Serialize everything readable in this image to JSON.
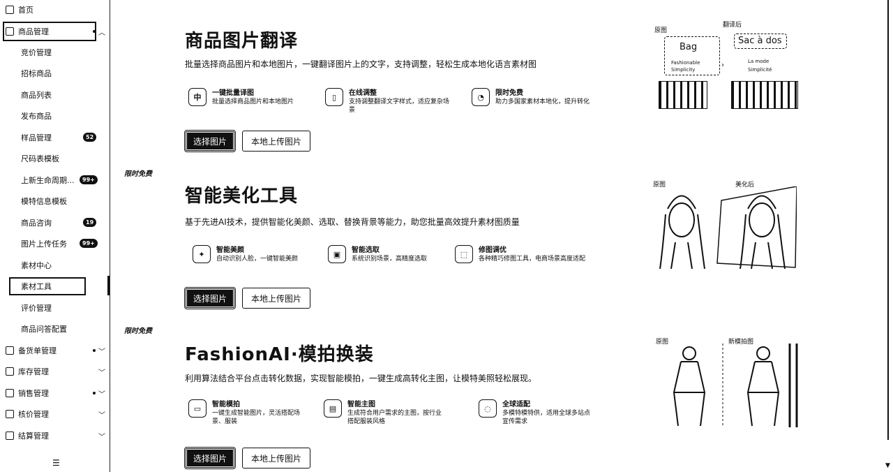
{
  "sidebar": {
    "home": "首页",
    "product_mgmt": "商品管理",
    "sub_items": [
      {
        "label": "竞价管理"
      },
      {
        "label": "招标商品"
      },
      {
        "label": "商品列表"
      },
      {
        "label": "发布商品"
      },
      {
        "label": "样品管理",
        "badge": "52"
      },
      {
        "label": "尺码表模板"
      },
      {
        "label": "上新生命周期...",
        "badge": "99+"
      },
      {
        "label": "模特信息模板"
      },
      {
        "label": "商品咨询",
        "badge": "19"
      },
      {
        "label": "图片上传任务",
        "badge": "99+"
      },
      {
        "label": "素材中心"
      },
      {
        "label": "素材工具"
      },
      {
        "label": "评价管理"
      },
      {
        "label": "商品问答配置"
      }
    ],
    "groups": [
      "备货单管理",
      "库存管理",
      "销售管理",
      "核价管理",
      "结算管理"
    ],
    "collapse_icon": "menu-collapse-icon"
  },
  "ribbons": [
    "限时免费",
    "限时免费"
  ],
  "sections": [
    {
      "title": "商品图片翻译",
      "desc": "批量选择商品图片和本地图片，一键翻译图片上的文字，支持调整，轻松生成本地化语言素材图",
      "features": [
        {
          "icon": "中",
          "title": "一键批量译图",
          "desc": "批量选择商品图片和本地图片"
        },
        {
          "icon": "▯",
          "title": "在线调整",
          "desc": "支持调整翻译文字样式，适应复杂场景"
        },
        {
          "icon": "◔",
          "title": "限时免费",
          "desc": "助力多国家素材本地化，提升转化"
        }
      ],
      "btn_select": "选择图片",
      "btn_upload": "本地上传图片",
      "preview": {
        "before": "原图",
        "after": "翻译后",
        "src_word": "Bag",
        "dst_word": "Sac à dos",
        "src_tags": [
          "Fashionable",
          "Simplicity"
        ],
        "dst_tags": [
          "La mode",
          "Simplicité"
        ]
      }
    },
    {
      "title": "智能美化工具",
      "desc": "基于先进AI技术，提供智能化美颜、选取、替换背景等能力，助您批量高效提升素材图质量",
      "features": [
        {
          "icon": "✦",
          "title": "智能美颜",
          "desc": "自动识别人脸，一键智能美颜"
        },
        {
          "icon": "▣",
          "title": "智能选取",
          "desc": "系统识别场景，高精度选取"
        },
        {
          "icon": "⬚",
          "title": "修图调优",
          "desc": "各种精巧修图工具，电商场景高度适配"
        }
      ],
      "btn_select": "选择图片",
      "btn_upload": "本地上传图片",
      "preview": {
        "before": "原图",
        "after": "美化后"
      }
    },
    {
      "title": "FashionAI·模拍换装",
      "desc": "利用算法结合平台点击转化数据，实现智能模拍，一键生成高转化主图，让模特美照轻松展现。",
      "features": [
        {
          "icon": "▭",
          "title": "智能模拍",
          "desc": "一键生成智能图片，灵活搭配场景、服装"
        },
        {
          "icon": "▤",
          "title": "智能主图",
          "desc": "生成符合用户需求的主图，按行业搭配服装风格"
        },
        {
          "icon": "◌",
          "title": "全球适配",
          "desc": "多模特模特供，适用全球多站点宣传需求"
        }
      ],
      "btn_select": "选择图片",
      "btn_upload": "本地上传图片",
      "preview": {
        "before": "原图",
        "after": "新模拍图"
      }
    }
  ]
}
